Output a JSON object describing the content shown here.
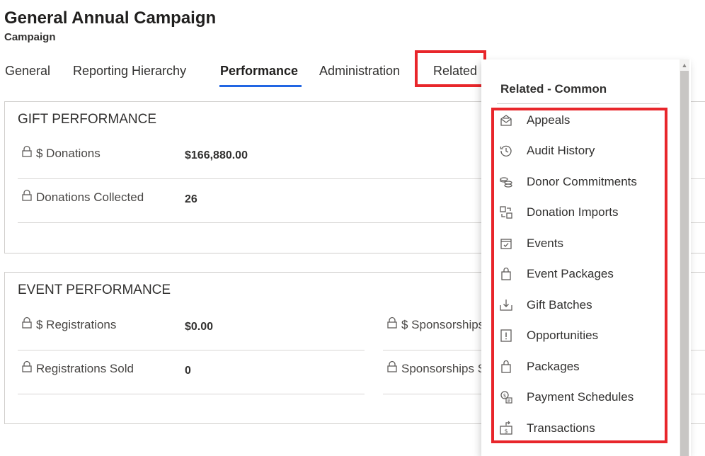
{
  "header": {
    "title": "General Annual Campaign",
    "subtitle": "Campaign"
  },
  "tabs": [
    {
      "label": "General"
    },
    {
      "label": "Reporting Hierarchy"
    },
    {
      "label": "Performance",
      "active": true
    },
    {
      "label": "Administration"
    },
    {
      "label": "Related"
    }
  ],
  "gift_performance": {
    "title": "GIFT PERFORMANCE",
    "fields": [
      {
        "label": "$ Donations",
        "value": "$166,880.00"
      },
      {
        "label": "Donations Collected",
        "value": "26"
      }
    ]
  },
  "event_performance": {
    "title": "EVENT PERFORMANCE",
    "fields": [
      {
        "label": "$ Registrations",
        "value": "$0.00"
      },
      {
        "label": "$ Sponsorships",
        "value": ""
      },
      {
        "label": "Registrations Sold",
        "value": "0"
      },
      {
        "label": "Sponsorships S",
        "value": ""
      }
    ]
  },
  "related_menu": {
    "header": "Related - Common",
    "items": [
      {
        "label": "Appeals",
        "icon": "envelope-open-icon"
      },
      {
        "label": "Audit History",
        "icon": "history-clock-icon"
      },
      {
        "label": "Donor Commitments",
        "icon": "coins-stack-icon"
      },
      {
        "label": "Donation Imports",
        "icon": "import-icon"
      },
      {
        "label": "Events",
        "icon": "calendar-check-icon"
      },
      {
        "label": "Event Packages",
        "icon": "shopping-bag-icon"
      },
      {
        "label": "Gift Batches",
        "icon": "tray-download-icon"
      },
      {
        "label": "Opportunities",
        "icon": "alert-card-icon"
      },
      {
        "label": "Packages",
        "icon": "shopping-bag-icon"
      },
      {
        "label": "Payment Schedules",
        "icon": "payment-schedule-icon"
      },
      {
        "label": "Transactions",
        "icon": "money-transfer-icon"
      }
    ]
  },
  "colors": {
    "accent": "#2266e3",
    "highlight": "#e8262b"
  }
}
